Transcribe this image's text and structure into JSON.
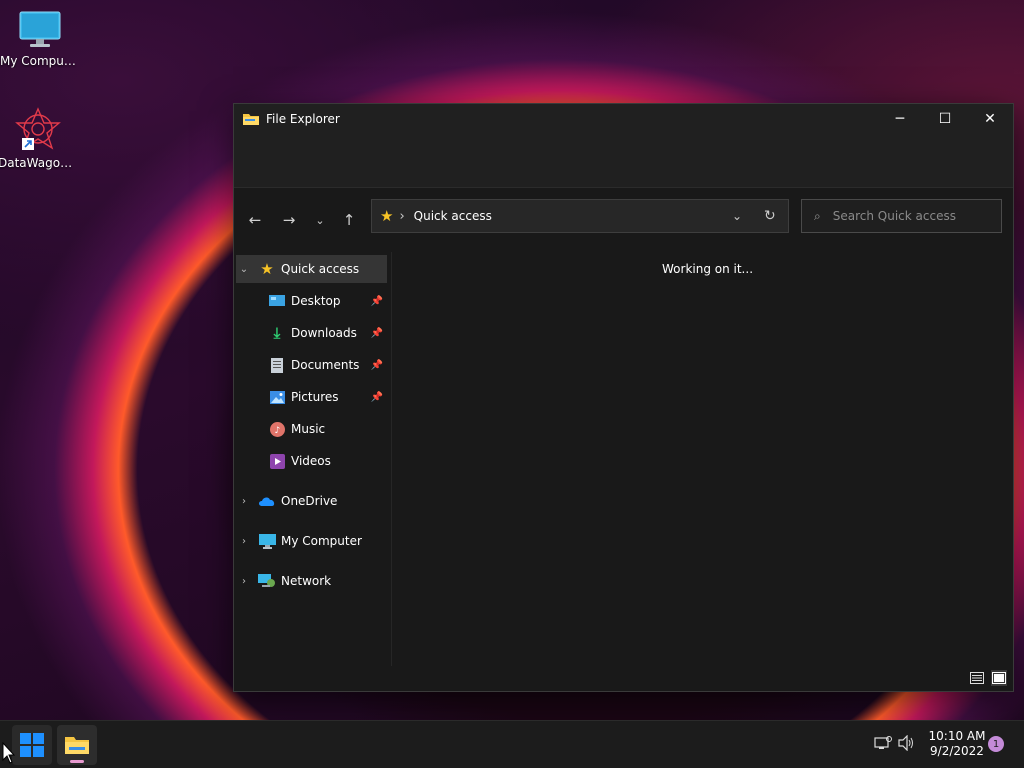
{
  "desktop": {
    "icons": [
      {
        "label": "My Computer",
        "icon": "monitor-icon"
      },
      {
        "label": "DataWagon...",
        "icon": "datawagon-shortcut-icon"
      }
    ]
  },
  "window": {
    "title": "File Explorer",
    "controls": {
      "minimize": "─",
      "maximize": "☐",
      "close": "✕"
    },
    "address": {
      "location": "Quick access",
      "separator": "›"
    },
    "search": {
      "placeholder": "Search Quick access"
    },
    "content": {
      "status": "Working on it..."
    },
    "sidebar": {
      "quick_access": "Quick access",
      "pinned": [
        {
          "label": "Desktop",
          "pinned": true
        },
        {
          "label": "Downloads",
          "pinned": true
        },
        {
          "label": "Documents",
          "pinned": true
        },
        {
          "label": "Pictures",
          "pinned": true
        },
        {
          "label": "Music",
          "pinned": false
        },
        {
          "label": "Videos",
          "pinned": false
        }
      ],
      "roots": [
        "OneDrive",
        "My Computer",
        "Network"
      ]
    }
  },
  "taskbar": {
    "time": "10:10 AM",
    "date": "9/2/2022",
    "notification_count": "1"
  },
  "colors": {
    "accent_blue": "#1e90ff",
    "folder_yellow": "#f5c542",
    "star": "#f7c326",
    "notification_badge": "#c48bd8"
  }
}
